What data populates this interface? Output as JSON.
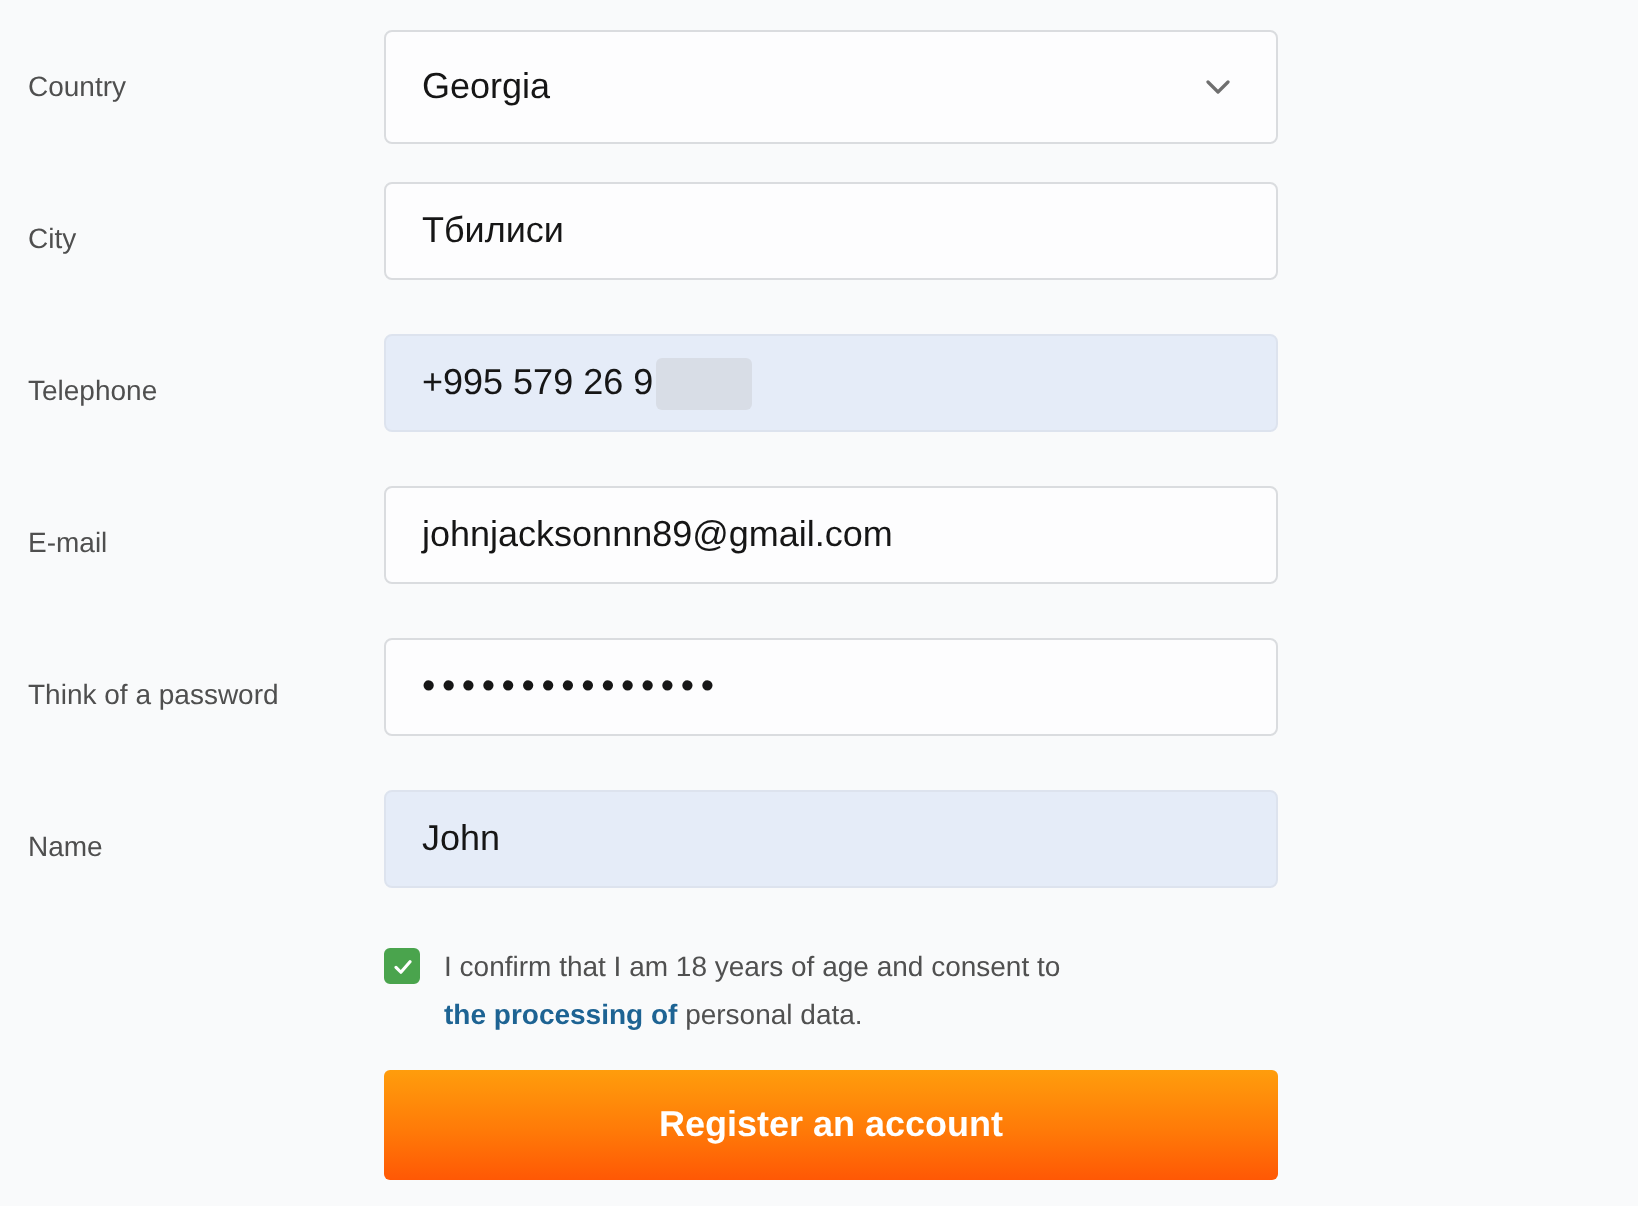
{
  "form": {
    "fields": [
      {
        "kind": "select",
        "label": "Country",
        "value": "Georgia",
        "autofilled": false,
        "redacted": false
      },
      {
        "kind": "text",
        "label": "City",
        "value": "Тбилиси",
        "autofilled": false,
        "redacted": false
      },
      {
        "kind": "text",
        "label": "Telephone",
        "value": "+995 579 26 9",
        "autofilled": true,
        "redacted": true
      },
      {
        "kind": "text",
        "label": "E-mail",
        "value": "johnjacksonnn89@gmail.com",
        "autofilled": false,
        "redacted": false
      },
      {
        "kind": "password",
        "label": "Think of a password",
        "value": "•••••••••••••••",
        "autofilled": false,
        "redacted": false
      },
      {
        "kind": "text",
        "label": "Name",
        "value": "John",
        "autofilled": true,
        "redacted": false
      }
    ]
  },
  "consent": {
    "checked": true,
    "text_before": "I confirm that I am 18 years of age and consent to",
    "link": "the processing of",
    "text_after": "personal data."
  },
  "submit_button": {
    "label": "Register an account"
  }
}
